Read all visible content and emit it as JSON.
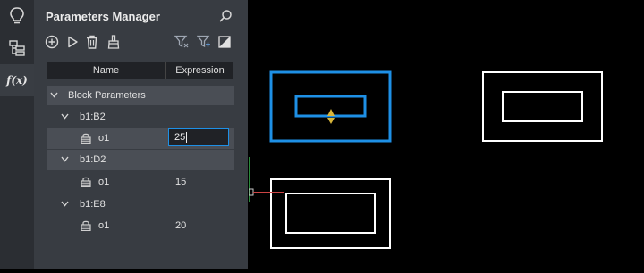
{
  "sidebar": {
    "items": [
      {
        "icon": "lightbulb-icon"
      },
      {
        "icon": "tree-icon"
      },
      {
        "icon": "function-icon",
        "label": "f(x)"
      }
    ]
  },
  "panel": {
    "title": "Parameters Manager",
    "toolbar": [
      "add-icon",
      "play-icon",
      "trash-icon",
      "brush-icon",
      "filter-icon",
      "filter-clear-icon",
      "contrast-icon"
    ],
    "columns": {
      "name": "Name",
      "expression": "Expression"
    },
    "group": "Block Parameters",
    "blocks": [
      {
        "name": "b1:B2",
        "param": "o1",
        "value": "25"
      },
      {
        "name": "b1:D2",
        "param": "o1",
        "value": "15"
      },
      {
        "name": "b1:E8",
        "param": "o1",
        "value": "20"
      }
    ]
  },
  "colors": {
    "accent": "#1e90e6",
    "grip": "#d8b53a",
    "panel": "#383c42",
    "sidebar": "#2b2e33"
  }
}
